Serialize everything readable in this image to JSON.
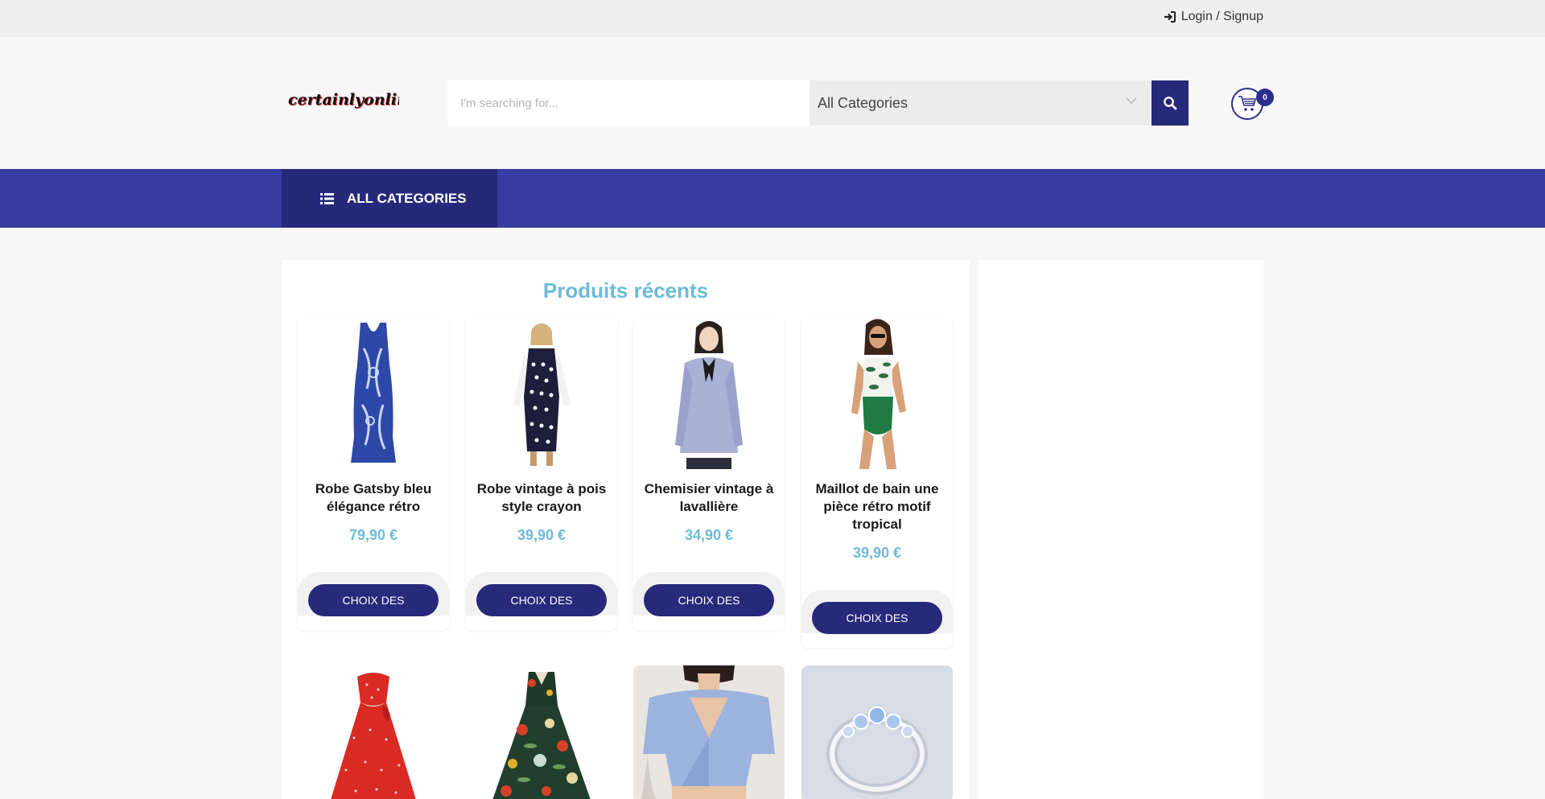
{
  "topbar": {
    "login_label": "Login / Signup"
  },
  "header": {
    "logo_text": "certainlyonline",
    "search_placeholder": "I'm searching for...",
    "category_select": "All Categories",
    "cart_count": "0"
  },
  "nav": {
    "all_categories": "ALL CATEGORIES"
  },
  "section": {
    "title": "Produits récents"
  },
  "products": [
    {
      "title": "Robe Gatsby bleu élégance rétro",
      "price": "79,90 €",
      "button": "CHOIX DES"
    },
    {
      "title": "Robe vintage à pois style crayon",
      "price": "39,90 €",
      "button": "CHOIX DES"
    },
    {
      "title": "Chemisier vintage à lavallière",
      "price": "34,90 €",
      "button": "CHOIX DES"
    },
    {
      "title": "Maillot de bain une pièce rétro motif tropical",
      "price": "39,90 €",
      "button": "CHOIX DES"
    }
  ],
  "colors": {
    "primary": "#27297a",
    "nav": "#373da0",
    "accent": "#6cbbd9"
  }
}
